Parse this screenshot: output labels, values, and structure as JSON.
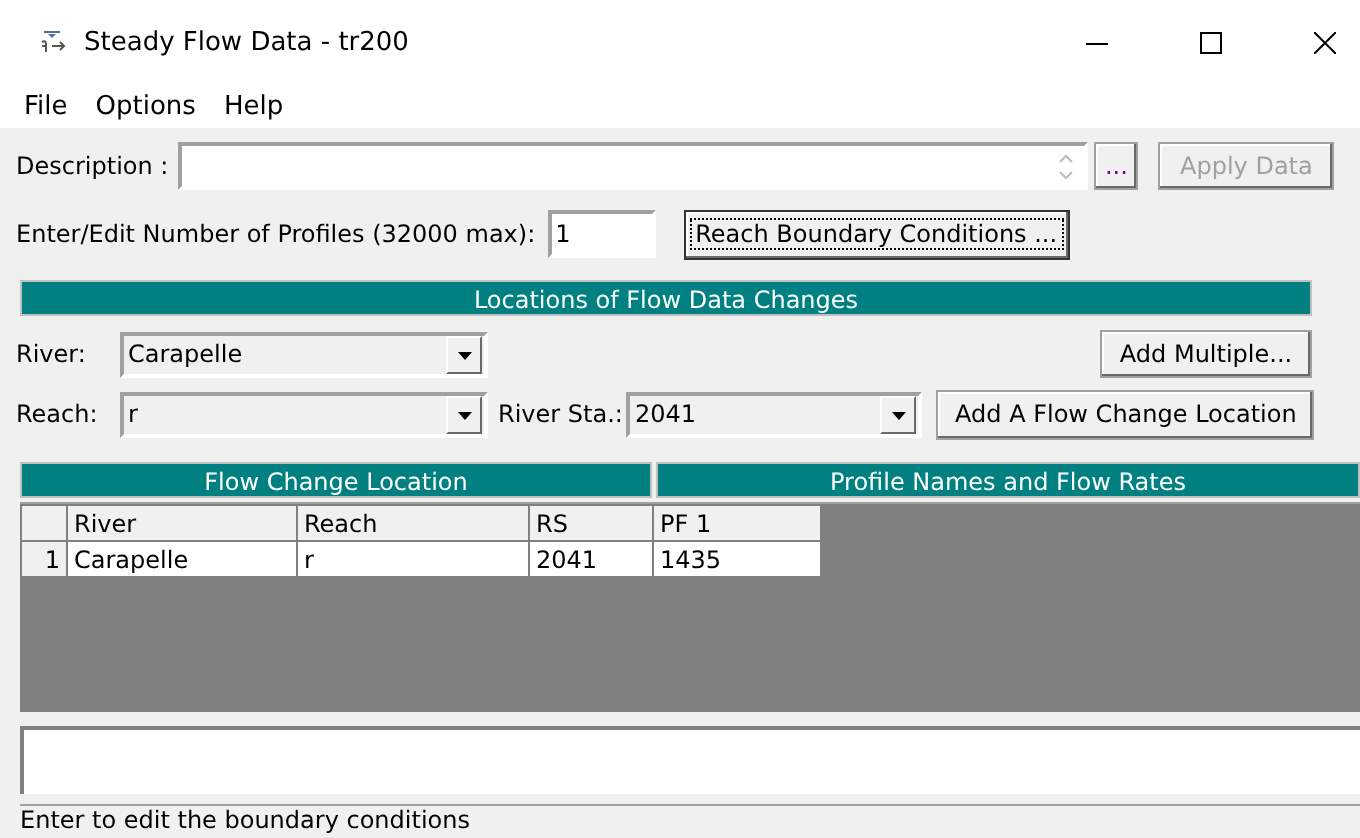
{
  "window": {
    "title": "Steady Flow Data - tr200"
  },
  "menu": [
    "File",
    "Options",
    "Help"
  ],
  "description": {
    "label": "Description :",
    "browse_button": "...",
    "apply_button": {
      "label": "Apply Data",
      "disabled": true
    }
  },
  "profiles": {
    "label": "Enter/Edit Number of Profiles (32000 max):",
    "value": "1",
    "button": {
      "label": "Reach Boundary Conditions ...",
      "focused": true
    }
  },
  "locations": {
    "title": "Locations of Flow Data Changes",
    "river_label": "River:",
    "river": "Carapelle",
    "reach_label": "Reach:",
    "reach": "r",
    "station_label": "River Sta.:",
    "station": "2041",
    "add_multiple_button": "Add Multiple...",
    "add_location_button": "Add A Flow Change Location"
  },
  "table": {
    "left_title": "Flow Change Location",
    "right_title": "Profile Names and Flow Rates",
    "columns": [
      "River",
      "Reach",
      "RS",
      "PF 1"
    ],
    "rows": [
      {
        "number": "1",
        "cells": [
          "Carapelle",
          "r",
          "2041",
          "1435"
        ]
      }
    ]
  },
  "status_bar": "Enter to edit the boundary conditions"
}
